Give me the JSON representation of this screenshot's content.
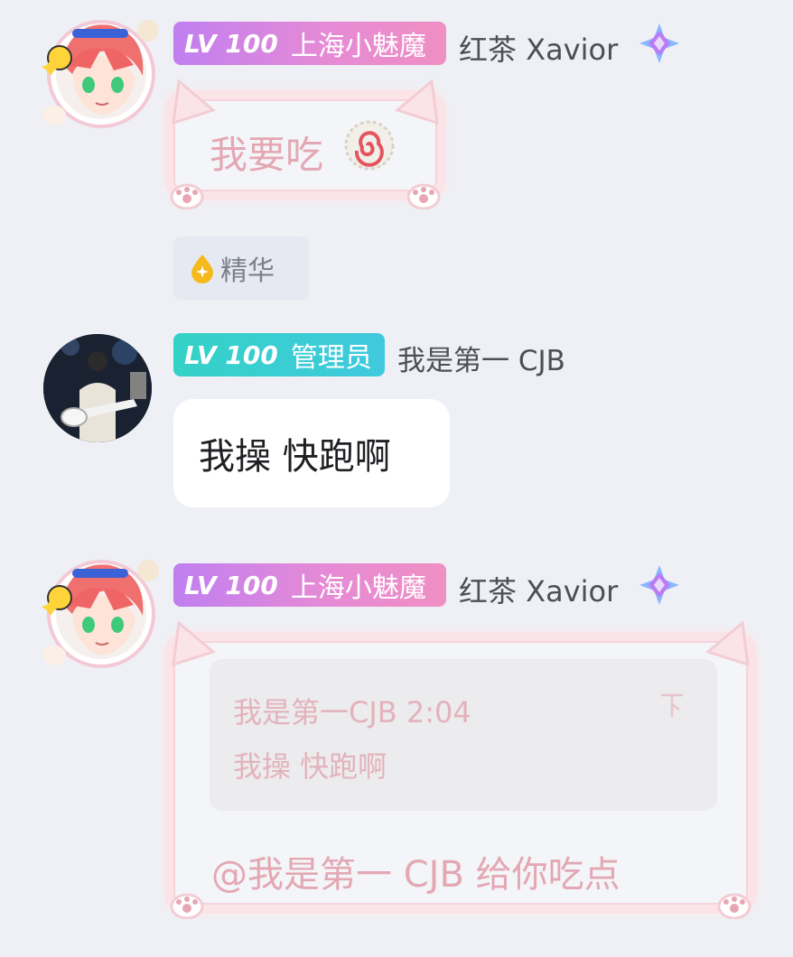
{
  "messages": [
    {
      "badge": {
        "level": "LV 100",
        "title": "上海小魅魔",
        "color": "#e58ad6"
      },
      "nickname": "红茶 Xavior",
      "bubble_text": "我要吃"
    },
    {
      "tag": {
        "label": "精华",
        "color": "#f5b91c"
      }
    },
    {
      "badge": {
        "level": "LV 100",
        "title": "管理员",
        "color": "#38cfcf"
      },
      "nickname": "我是第一 CJB",
      "bubble_text": "我操 快跑啊"
    },
    {
      "badge": {
        "level": "LV 100",
        "title": "上海小魅魔",
        "color": "#e58ad6"
      },
      "nickname": "红茶 Xavior",
      "quote": {
        "author_time": "我是第一CJB 2:04",
        "text": "我操 快跑啊"
      },
      "bubble_text": "@我是第一 CJB 给你吃点"
    }
  ],
  "icons": {
    "vip": "diamond-crystal-icon",
    "food": "naruto-fishcake-icon",
    "essence": "drop-icon",
    "quote_pin": "pin-icon"
  },
  "colors": {
    "background": "#eef0f5",
    "pink_badge": "#e58ad6",
    "teal_badge": "#38cfcf",
    "cat_frame": "#fbe4e8",
    "pink_text": "#e3a8b3"
  }
}
